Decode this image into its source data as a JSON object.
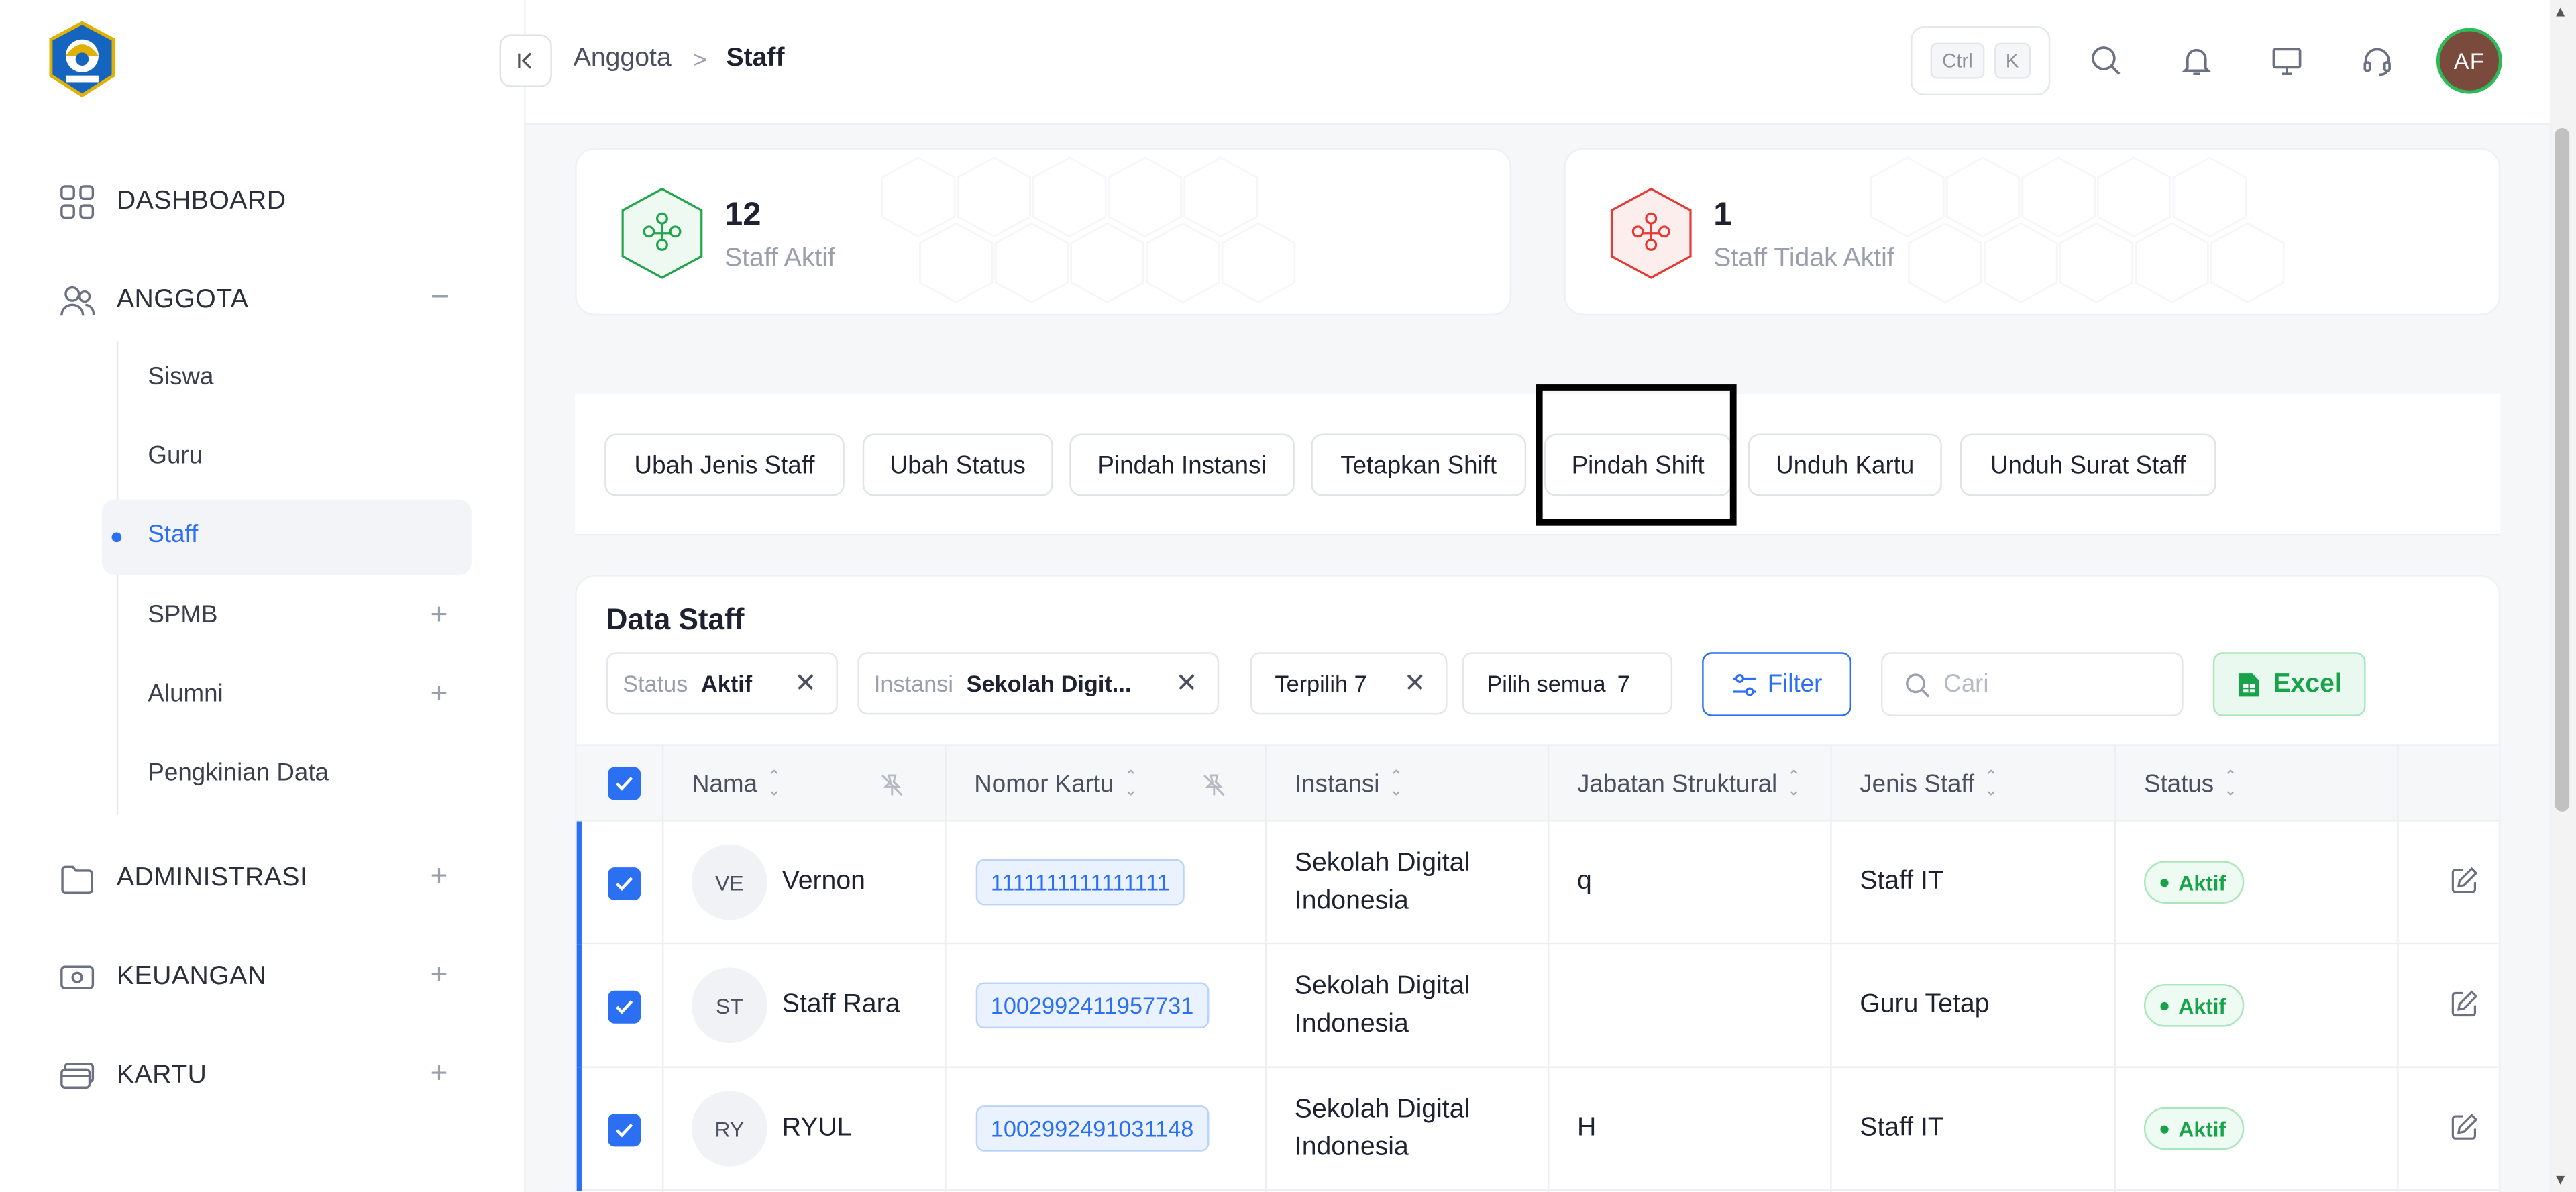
{
  "header": {
    "breadcrumb_parent": "Anggota",
    "breadcrumb_current": "Staff",
    "shortcut_ctrl": "Ctrl",
    "shortcut_key": "K",
    "avatar_initials": "AF"
  },
  "sidebar": {
    "dashboard": "DASHBOARD",
    "anggota": "ANGGOTA",
    "anggota_sub": [
      "Siswa",
      "Guru",
      "Staff",
      "SPMB",
      "Alumni",
      "Pengkinian Data"
    ],
    "administrasi": "ADMINISTRASI",
    "keuangan": "KEUANGAN",
    "kartu": "KARTU"
  },
  "stats": {
    "active_count": "12",
    "active_label": "Staff Aktif",
    "inactive_count": "1",
    "inactive_label": "Staff Tidak Aktif"
  },
  "actions": [
    "Ubah Jenis Staff",
    "Ubah Status",
    "Pindah Instansi",
    "Tetapkan Shift",
    "Pindah Shift",
    "Unduh Kartu",
    "Unduh Surat Staff"
  ],
  "data_panel": {
    "title": "Data Staff",
    "filter_status_key": "Status",
    "filter_status_value": "Aktif",
    "filter_instansi_key": "Instansi",
    "filter_instansi_value": "Sekolah Digit...",
    "selected_label": "Terpilih 7",
    "select_all_label": "Pilih semua",
    "select_all_count": "7",
    "filter_button": "Filter",
    "search_placeholder": "Cari",
    "excel_button": "Excel"
  },
  "table": {
    "columns": [
      "Nama",
      "Nomor Kartu",
      "Instansi",
      "Jabatan Struktural",
      "Jenis Staff",
      "Status"
    ],
    "rows": [
      {
        "initials": "VE",
        "name": "Vernon",
        "card": "1111111111111111",
        "inst1": "Sekolah Digital",
        "inst2": "Indonesia",
        "jabatan": "q",
        "jenis": "Staff IT",
        "status": "Aktif"
      },
      {
        "initials": "ST",
        "name": "Staff Rara",
        "card": "1002992411957731",
        "inst1": "Sekolah Digital",
        "inst2": "Indonesia",
        "jabatan": "",
        "jenis": "Guru Tetap",
        "status": "Aktif"
      },
      {
        "initials": "RY",
        "name": "RYUL",
        "card": "1002992491031148",
        "inst1": "Sekolah Digital",
        "inst2": "Indonesia",
        "jabatan": "H",
        "jenis": "Staff IT",
        "status": "Aktif"
      }
    ]
  },
  "colors": {
    "accent": "#2b6ff3",
    "success": "#16a34a",
    "danger": "#e53935"
  }
}
